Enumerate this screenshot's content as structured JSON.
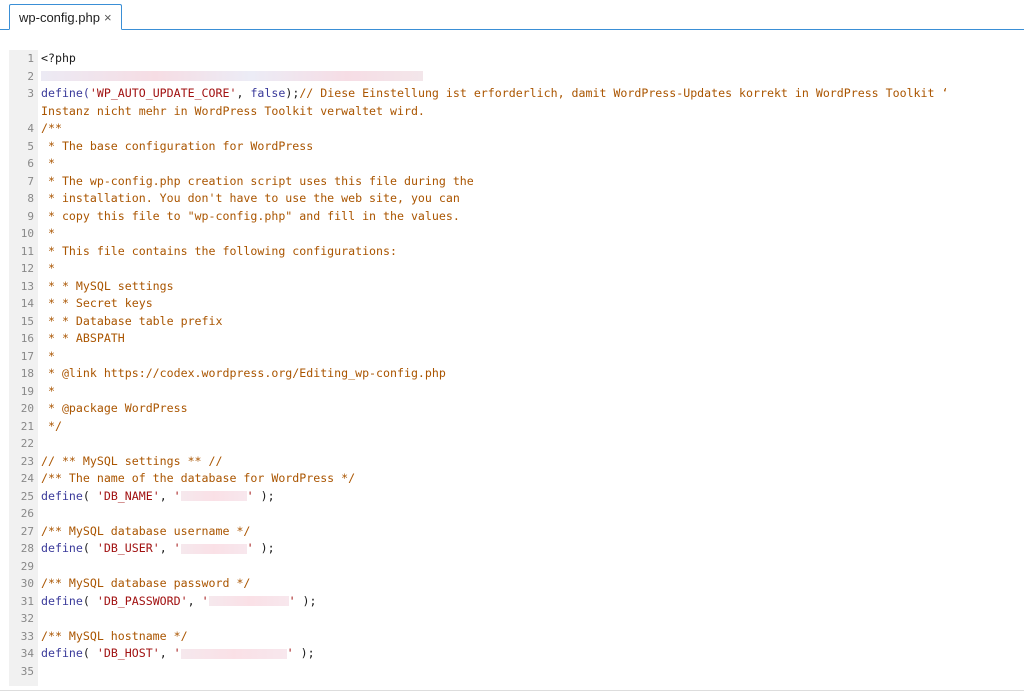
{
  "tab": {
    "title": "wp-config.php",
    "close": "×"
  },
  "editor": {
    "lines": [
      {
        "n": "1",
        "parts": [
          {
            "t": "<?php",
            "c": "tag"
          }
        ]
      },
      {
        "n": "2",
        "parts": [],
        "redact": "wide"
      },
      {
        "n": "3",
        "parts": [
          {
            "t": "define(",
            "c": "kw"
          },
          {
            "t": "'WP_AUTO_UPDATE_CORE'",
            "c": "str"
          },
          {
            "t": ", ",
            "c": "punct"
          },
          {
            "t": "false",
            "c": "kw"
          },
          {
            "t": ");",
            "c": "punct"
          },
          {
            "t": "// Diese Einstellung ist erforderlich, damit WordPress-Updates korrekt in WordPress Toolkit ‘",
            "c": "comment"
          }
        ]
      },
      {
        "n": "",
        "parts": [
          {
            "t": "Instanz nicht mehr in WordPress Toolkit verwaltet wird.",
            "c": "comment"
          }
        ]
      },
      {
        "n": "4",
        "parts": [
          {
            "t": "/**",
            "c": "comment"
          }
        ]
      },
      {
        "n": "5",
        "parts": [
          {
            "t": " * The base configuration for WordPress",
            "c": "comment"
          }
        ]
      },
      {
        "n": "6",
        "parts": [
          {
            "t": " *",
            "c": "comment"
          }
        ]
      },
      {
        "n": "7",
        "parts": [
          {
            "t": " * The wp-config.php creation script uses this file during the",
            "c": "comment"
          }
        ]
      },
      {
        "n": "8",
        "parts": [
          {
            "t": " * installation. You don't have to use the web site, you can",
            "c": "comment"
          }
        ]
      },
      {
        "n": "9",
        "parts": [
          {
            "t": " * copy this file to \"wp-config.php\" and fill in the values.",
            "c": "comment"
          }
        ]
      },
      {
        "n": "10",
        "parts": [
          {
            "t": " *",
            "c": "comment"
          }
        ]
      },
      {
        "n": "11",
        "parts": [
          {
            "t": " * This file contains the following configurations:",
            "c": "comment"
          }
        ]
      },
      {
        "n": "12",
        "parts": [
          {
            "t": " *",
            "c": "comment"
          }
        ]
      },
      {
        "n": "13",
        "parts": [
          {
            "t": " * * MySQL settings",
            "c": "comment"
          }
        ]
      },
      {
        "n": "14",
        "parts": [
          {
            "t": " * * Secret keys",
            "c": "comment"
          }
        ]
      },
      {
        "n": "15",
        "parts": [
          {
            "t": " * * Database table prefix",
            "c": "comment"
          }
        ]
      },
      {
        "n": "16",
        "parts": [
          {
            "t": " * * ABSPATH",
            "c": "comment"
          }
        ]
      },
      {
        "n": "17",
        "parts": [
          {
            "t": " *",
            "c": "comment"
          }
        ]
      },
      {
        "n": "18",
        "parts": [
          {
            "t": " * @link https://codex.wordpress.org/Editing_wp-config.php",
            "c": "comment"
          }
        ]
      },
      {
        "n": "19",
        "parts": [
          {
            "t": " *",
            "c": "comment"
          }
        ]
      },
      {
        "n": "20",
        "parts": [
          {
            "t": " * @package WordPress",
            "c": "comment"
          }
        ]
      },
      {
        "n": "21",
        "parts": [
          {
            "t": " */",
            "c": "comment"
          }
        ]
      },
      {
        "n": "22",
        "parts": []
      },
      {
        "n": "23",
        "parts": [
          {
            "t": "// ** MySQL settings ** //",
            "c": "comment"
          }
        ]
      },
      {
        "n": "24",
        "parts": [
          {
            "t": "/** The name of the database for WordPress */",
            "c": "comment"
          }
        ]
      },
      {
        "n": "25",
        "parts": [
          {
            "t": "define",
            "c": "kw"
          },
          {
            "t": "( ",
            "c": "punct"
          },
          {
            "t": "'DB_NAME'",
            "c": "str"
          },
          {
            "t": ", ",
            "c": "punct"
          },
          {
            "t": "'",
            "c": "str"
          },
          {
            "t": "",
            "c": "str",
            "redact": 66
          },
          {
            "t": "'",
            "c": "str"
          },
          {
            "t": " );",
            "c": "punct"
          }
        ]
      },
      {
        "n": "26",
        "parts": []
      },
      {
        "n": "27",
        "parts": [
          {
            "t": "/** MySQL database username */",
            "c": "comment"
          }
        ]
      },
      {
        "n": "28",
        "parts": [
          {
            "t": "define",
            "c": "kw"
          },
          {
            "t": "( ",
            "c": "punct"
          },
          {
            "t": "'DB_USER'",
            "c": "str"
          },
          {
            "t": ", ",
            "c": "punct"
          },
          {
            "t": "'",
            "c": "str"
          },
          {
            "t": "",
            "c": "str",
            "redact": 66
          },
          {
            "t": "'",
            "c": "str"
          },
          {
            "t": " );",
            "c": "punct"
          }
        ]
      },
      {
        "n": "29",
        "parts": []
      },
      {
        "n": "30",
        "parts": [
          {
            "t": "/** MySQL database password */",
            "c": "comment"
          }
        ]
      },
      {
        "n": "31",
        "parts": [
          {
            "t": "define",
            "c": "kw"
          },
          {
            "t": "( ",
            "c": "punct"
          },
          {
            "t": "'DB_PASSWORD'",
            "c": "str"
          },
          {
            "t": ", ",
            "c": "punct"
          },
          {
            "t": "'",
            "c": "str"
          },
          {
            "t": "",
            "c": "str",
            "redact": 80
          },
          {
            "t": "'",
            "c": "str"
          },
          {
            "t": " );",
            "c": "punct"
          }
        ]
      },
      {
        "n": "32",
        "parts": []
      },
      {
        "n": "33",
        "parts": [
          {
            "t": "/** MySQL hostname */",
            "c": "comment"
          }
        ]
      },
      {
        "n": "34",
        "parts": [
          {
            "t": "define",
            "c": "kw"
          },
          {
            "t": "( ",
            "c": "punct"
          },
          {
            "t": "'DB_HOST'",
            "c": "str"
          },
          {
            "t": ", ",
            "c": "punct"
          },
          {
            "t": "'",
            "c": "str"
          },
          {
            "t": "",
            "c": "str",
            "redact": 106
          },
          {
            "t": "'",
            "c": "str"
          },
          {
            "t": " );",
            "c": "punct"
          }
        ]
      },
      {
        "n": "35",
        "parts": []
      }
    ]
  },
  "colors": {
    "comment": "#aa5500",
    "keyword": "#3a3a9a",
    "string": "#a11111",
    "tab_border": "#3a8fd6",
    "gutter_bg": "#f1f1f1"
  }
}
